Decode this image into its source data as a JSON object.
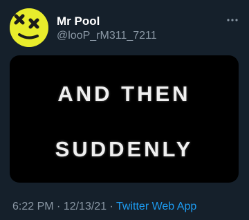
{
  "tweet": {
    "display_name": "Mr Pool",
    "handle": "@looP_rM311_7211",
    "media_text": [
      "AND THEN",
      "SUDDENLY"
    ],
    "time": "6:22 PM",
    "separator": " · ",
    "date": "12/13/21",
    "source": "Twitter Web App"
  },
  "icons": {
    "avatar": "dizzy-face-avatar-icon",
    "more": "more-options-icon"
  },
  "colors": {
    "background": "#15202b",
    "avatar": "#e8ec2c",
    "link": "#1d9bf0",
    "secondary_text": "#8b98a5"
  }
}
